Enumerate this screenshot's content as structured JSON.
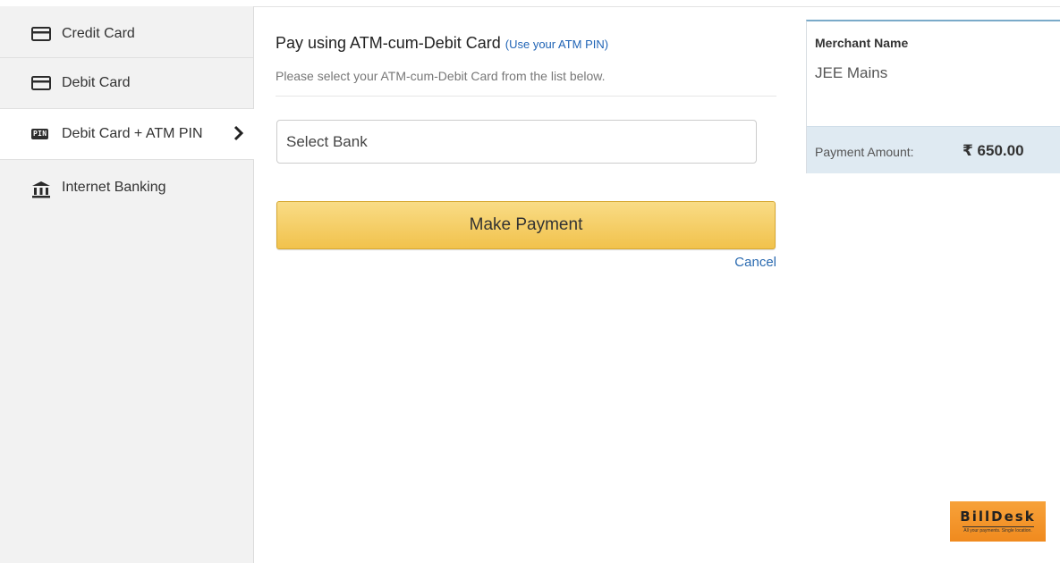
{
  "sidebar": {
    "items": [
      {
        "label": "Credit Card",
        "icon": "card-icon"
      },
      {
        "label": "Debit Card",
        "icon": "card-icon"
      },
      {
        "label": "Debit Card + ATM PIN",
        "icon": "pin-icon",
        "badge": "PIN",
        "active": true
      },
      {
        "label": "Internet Banking",
        "icon": "bank-icon"
      }
    ]
  },
  "main": {
    "title": "Pay using ATM-cum-Debit Card",
    "title_note": "(Use your ATM PIN)",
    "subtitle": "Please select your ATM-cum-Debit Card from the list below.",
    "select_placeholder": "Select Bank",
    "pay_button": "Make Payment",
    "cancel": "Cancel"
  },
  "merchant": {
    "label": "Merchant Name",
    "name": "JEE Mains",
    "amount_label": "Payment Amount:",
    "amount": "₹ 650.00"
  },
  "logo": {
    "name": "BillDesk",
    "tagline": "All your payments. Single location."
  },
  "colors": {
    "button": "#f1c24c",
    "link": "#1f63b5",
    "logo": "#f08a1e",
    "amount_bar": "#dfeaf2"
  }
}
